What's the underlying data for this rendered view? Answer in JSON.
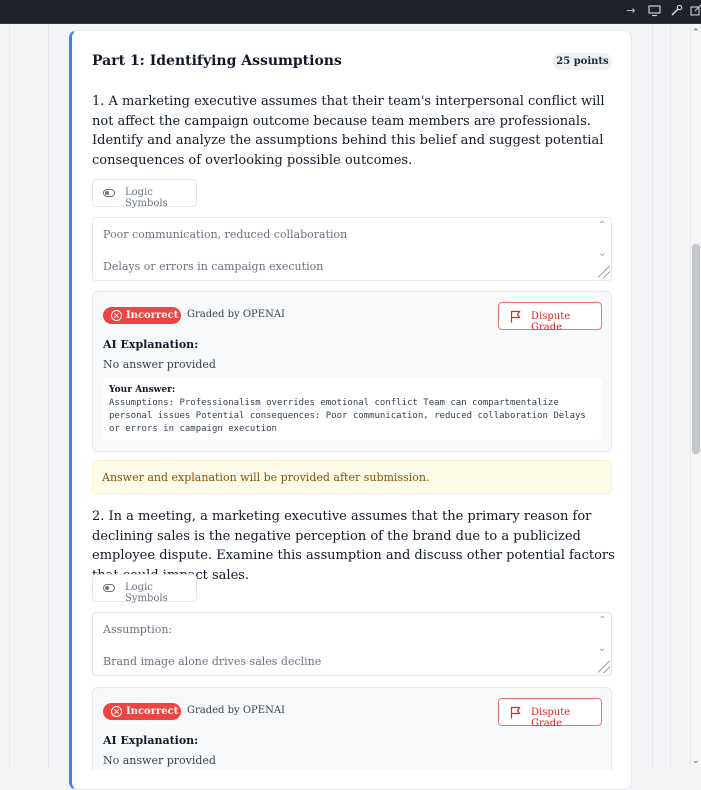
{
  "topbar": {
    "icons": [
      "arrow-right-icon",
      "desktop-icon",
      "wrench-icon",
      "external-link-icon"
    ]
  },
  "part": {
    "title": "Part 1: Identifying Assumptions",
    "points": "25 points"
  },
  "questions": [
    {
      "text": "1. A marketing executive assumes that their team's interpersonal conflict will not affect the campaign outcome because team members are professionals. Identify and analyze the assumptions behind this belief and suggest potential consequences of overlooking possible outcomes.",
      "logic_label": "Logic Symbols",
      "answer_lines": [
        "Poor communication, reduced collaboration",
        "Delays or errors in campaign execution"
      ],
      "grade": {
        "status": "Incorrect",
        "graded_by": "Graded by OPENAI",
        "dispute_label": "Dispute Grade",
        "ai_title": "AI Explanation:",
        "ai_text": "No answer provided",
        "your_answer_label": "Your Answer:",
        "your_answer_text": "Assumptions: Professionalism overrides emotional conflict Team can compartmentalize personal issues Potential consequences: Poor communication, reduced collaboration Delays or errors in campaign execution"
      }
    },
    {
      "text": "2. In a meeting, a marketing executive assumes that the primary reason for declining sales is the negative perception of the brand due to a publicized employee dispute. Examine this assumption and discuss other potential factors that could impact sales.",
      "logic_label": "Logic Symbols",
      "answer_lines": [
        "Assumption:",
        "Brand image alone drives sales decline"
      ],
      "grade": {
        "status": "Incorrect",
        "graded_by": "Graded by OPENAI",
        "dispute_label": "Dispute Grade",
        "ai_title": "AI Explanation:",
        "ai_text": "No answer provided"
      }
    }
  ],
  "notice": "Answer and explanation will be provided after submission."
}
